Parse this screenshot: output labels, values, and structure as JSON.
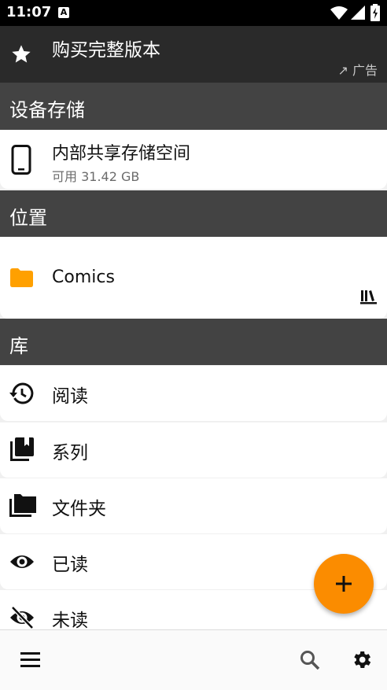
{
  "status_bar": {
    "time": "11:07",
    "a_badge": "A"
  },
  "promo": {
    "title": "购买完整版本",
    "ad_label": "↗ 广告"
  },
  "sections": {
    "device_storage": "设备存储",
    "locations": "位置",
    "library": "库"
  },
  "storage": {
    "name": "内部共享存储空间",
    "available": "可用 31.42 GB"
  },
  "location": {
    "name": "Comics"
  },
  "library_items": [
    {
      "label": "阅读",
      "icon": "history-icon"
    },
    {
      "label": "系列",
      "icon": "book-stack-icon"
    },
    {
      "label": "文件夹",
      "icon": "folders-icon"
    },
    {
      "label": "已读",
      "icon": "eye-icon"
    },
    {
      "label": "未读",
      "icon": "eye-off-icon"
    }
  ],
  "bottom_bar": {
    "menu_icon": "menu-icon",
    "search_icon": "search-icon",
    "settings_icon": "gear-icon"
  },
  "fab": {
    "icon": "plus-icon",
    "color": "#fb8c00"
  },
  "colors": {
    "section_bg": "#434343",
    "promo_bg": "#2a2a2a",
    "folder": "#ffa000"
  }
}
